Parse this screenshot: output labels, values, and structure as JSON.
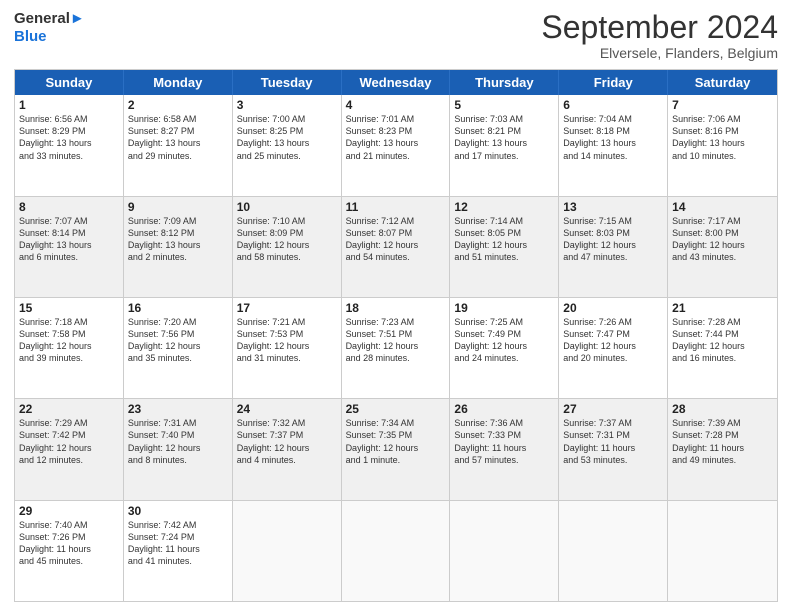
{
  "logo": {
    "line1": "General",
    "line2": "Blue"
  },
  "header": {
    "month": "September 2024",
    "location": "Elversele, Flanders, Belgium"
  },
  "days": [
    "Sunday",
    "Monday",
    "Tuesday",
    "Wednesday",
    "Thursday",
    "Friday",
    "Saturday"
  ],
  "rows": [
    [
      {
        "day": "1",
        "lines": [
          "Sunrise: 6:56 AM",
          "Sunset: 8:29 PM",
          "Daylight: 13 hours",
          "and 33 minutes."
        ]
      },
      {
        "day": "2",
        "lines": [
          "Sunrise: 6:58 AM",
          "Sunset: 8:27 PM",
          "Daylight: 13 hours",
          "and 29 minutes."
        ]
      },
      {
        "day": "3",
        "lines": [
          "Sunrise: 7:00 AM",
          "Sunset: 8:25 PM",
          "Daylight: 13 hours",
          "and 25 minutes."
        ]
      },
      {
        "day": "4",
        "lines": [
          "Sunrise: 7:01 AM",
          "Sunset: 8:23 PM",
          "Daylight: 13 hours",
          "and 21 minutes."
        ]
      },
      {
        "day": "5",
        "lines": [
          "Sunrise: 7:03 AM",
          "Sunset: 8:21 PM",
          "Daylight: 13 hours",
          "and 17 minutes."
        ]
      },
      {
        "day": "6",
        "lines": [
          "Sunrise: 7:04 AM",
          "Sunset: 8:18 PM",
          "Daylight: 13 hours",
          "and 14 minutes."
        ]
      },
      {
        "day": "7",
        "lines": [
          "Sunrise: 7:06 AM",
          "Sunset: 8:16 PM",
          "Daylight: 13 hours",
          "and 10 minutes."
        ]
      }
    ],
    [
      {
        "day": "8",
        "lines": [
          "Sunrise: 7:07 AM",
          "Sunset: 8:14 PM",
          "Daylight: 13 hours",
          "and 6 minutes."
        ]
      },
      {
        "day": "9",
        "lines": [
          "Sunrise: 7:09 AM",
          "Sunset: 8:12 PM",
          "Daylight: 13 hours",
          "and 2 minutes."
        ]
      },
      {
        "day": "10",
        "lines": [
          "Sunrise: 7:10 AM",
          "Sunset: 8:09 PM",
          "Daylight: 12 hours",
          "and 58 minutes."
        ]
      },
      {
        "day": "11",
        "lines": [
          "Sunrise: 7:12 AM",
          "Sunset: 8:07 PM",
          "Daylight: 12 hours",
          "and 54 minutes."
        ]
      },
      {
        "day": "12",
        "lines": [
          "Sunrise: 7:14 AM",
          "Sunset: 8:05 PM",
          "Daylight: 12 hours",
          "and 51 minutes."
        ]
      },
      {
        "day": "13",
        "lines": [
          "Sunrise: 7:15 AM",
          "Sunset: 8:03 PM",
          "Daylight: 12 hours",
          "and 47 minutes."
        ]
      },
      {
        "day": "14",
        "lines": [
          "Sunrise: 7:17 AM",
          "Sunset: 8:00 PM",
          "Daylight: 12 hours",
          "and 43 minutes."
        ]
      }
    ],
    [
      {
        "day": "15",
        "lines": [
          "Sunrise: 7:18 AM",
          "Sunset: 7:58 PM",
          "Daylight: 12 hours",
          "and 39 minutes."
        ]
      },
      {
        "day": "16",
        "lines": [
          "Sunrise: 7:20 AM",
          "Sunset: 7:56 PM",
          "Daylight: 12 hours",
          "and 35 minutes."
        ]
      },
      {
        "day": "17",
        "lines": [
          "Sunrise: 7:21 AM",
          "Sunset: 7:53 PM",
          "Daylight: 12 hours",
          "and 31 minutes."
        ]
      },
      {
        "day": "18",
        "lines": [
          "Sunrise: 7:23 AM",
          "Sunset: 7:51 PM",
          "Daylight: 12 hours",
          "and 28 minutes."
        ]
      },
      {
        "day": "19",
        "lines": [
          "Sunrise: 7:25 AM",
          "Sunset: 7:49 PM",
          "Daylight: 12 hours",
          "and 24 minutes."
        ]
      },
      {
        "day": "20",
        "lines": [
          "Sunrise: 7:26 AM",
          "Sunset: 7:47 PM",
          "Daylight: 12 hours",
          "and 20 minutes."
        ]
      },
      {
        "day": "21",
        "lines": [
          "Sunrise: 7:28 AM",
          "Sunset: 7:44 PM",
          "Daylight: 12 hours",
          "and 16 minutes."
        ]
      }
    ],
    [
      {
        "day": "22",
        "lines": [
          "Sunrise: 7:29 AM",
          "Sunset: 7:42 PM",
          "Daylight: 12 hours",
          "and 12 minutes."
        ]
      },
      {
        "day": "23",
        "lines": [
          "Sunrise: 7:31 AM",
          "Sunset: 7:40 PM",
          "Daylight: 12 hours",
          "and 8 minutes."
        ]
      },
      {
        "day": "24",
        "lines": [
          "Sunrise: 7:32 AM",
          "Sunset: 7:37 PM",
          "Daylight: 12 hours",
          "and 4 minutes."
        ]
      },
      {
        "day": "25",
        "lines": [
          "Sunrise: 7:34 AM",
          "Sunset: 7:35 PM",
          "Daylight: 12 hours",
          "and 1 minute."
        ]
      },
      {
        "day": "26",
        "lines": [
          "Sunrise: 7:36 AM",
          "Sunset: 7:33 PM",
          "Daylight: 11 hours",
          "and 57 minutes."
        ]
      },
      {
        "day": "27",
        "lines": [
          "Sunrise: 7:37 AM",
          "Sunset: 7:31 PM",
          "Daylight: 11 hours",
          "and 53 minutes."
        ]
      },
      {
        "day": "28",
        "lines": [
          "Sunrise: 7:39 AM",
          "Sunset: 7:28 PM",
          "Daylight: 11 hours",
          "and 49 minutes."
        ]
      }
    ],
    [
      {
        "day": "29",
        "lines": [
          "Sunrise: 7:40 AM",
          "Sunset: 7:26 PM",
          "Daylight: 11 hours",
          "and 45 minutes."
        ]
      },
      {
        "day": "30",
        "lines": [
          "Sunrise: 7:42 AM",
          "Sunset: 7:24 PM",
          "Daylight: 11 hours",
          "and 41 minutes."
        ]
      },
      {
        "day": "",
        "lines": []
      },
      {
        "day": "",
        "lines": []
      },
      {
        "day": "",
        "lines": []
      },
      {
        "day": "",
        "lines": []
      },
      {
        "day": "",
        "lines": []
      }
    ]
  ]
}
